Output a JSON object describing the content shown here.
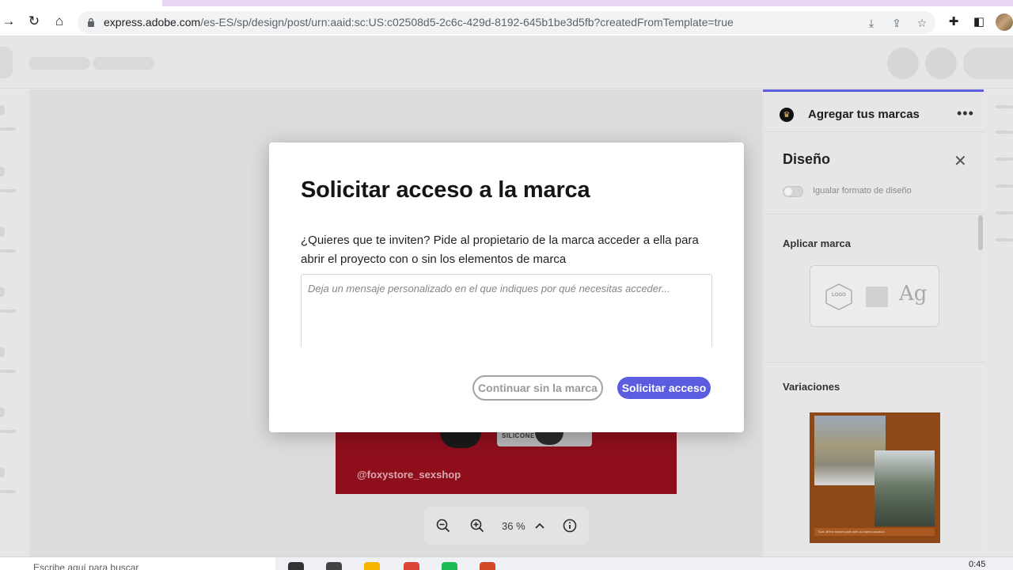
{
  "browser": {
    "url_host": "express.adobe.com",
    "url_path": "/es-ES/sp/design/post/urn:aaid:sc:US:c02508d5-2c6c-429d-8192-645b1be3d5fb?createdFromTemplate=true"
  },
  "canvas": {
    "product_label": "SILICONE",
    "handle": "@foxystore_sexshop",
    "zoom_value": "36 %"
  },
  "panel": {
    "brand_title": "Agregar tus marcas",
    "more_label": "•••",
    "design_title": "Diseño",
    "close_label": "✕",
    "toggle_label": "Igualar formato de diseño",
    "apply_brand_title": "Aplicar marca",
    "logo_label": "LOGO",
    "font_sample": "Ag",
    "variations_title": "Variaciones",
    "variation_caption": "Tuck off the beaten path with our latest vacation"
  },
  "modal": {
    "title": "Solicitar acceso a la marca",
    "description": "¿Quieres que te inviten? Pide al propietario de la marca acceder a ella para abrir el proyecto con o sin los elementos de marca",
    "message_placeholder": "Deja un mensaje personalizado en el que indiques por qué necesitas acceder...",
    "message_value": "",
    "continue_label": "Continuar sin la marca",
    "request_label": "Solicitar acceso"
  },
  "taskbar": {
    "search_text": "Escribe aquí para buscar",
    "clock": "0:45"
  },
  "colors": {
    "accent": "#5c5ce0",
    "artboard": "#8e0e1c",
    "variation_bg": "#8e4716"
  }
}
